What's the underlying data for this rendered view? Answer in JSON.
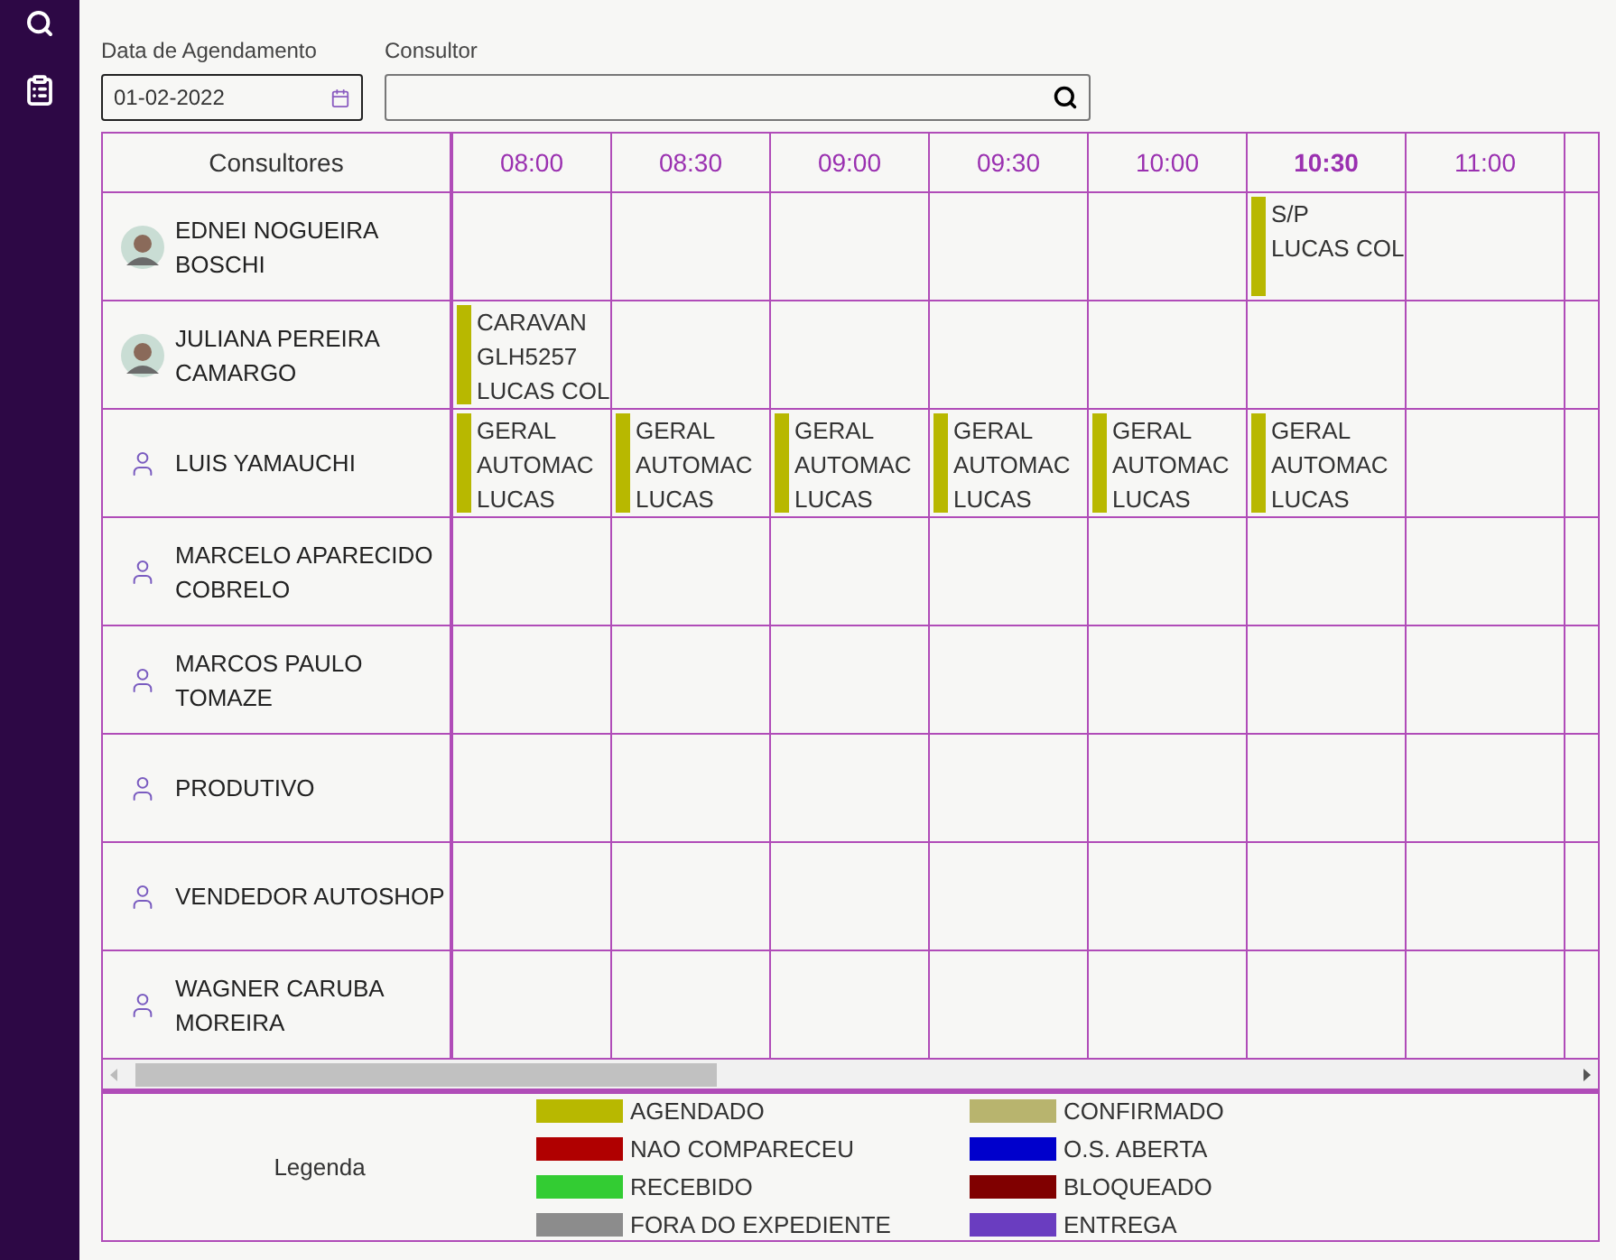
{
  "filters": {
    "date": {
      "label": "Data de Agendamento",
      "value": "01-02-2022"
    },
    "consultant": {
      "label": "Consultor"
    }
  },
  "schedule": {
    "header": "Consultores",
    "times": [
      {
        "label": "08:00",
        "current": false
      },
      {
        "label": "08:30",
        "current": false
      },
      {
        "label": "09:00",
        "current": false
      },
      {
        "label": "09:30",
        "current": false
      },
      {
        "label": "10:00",
        "current": false
      },
      {
        "label": "10:30",
        "current": true
      },
      {
        "label": "11:00",
        "current": false
      }
    ],
    "rows": [
      {
        "name": "EDNEI NOGUEIRA BOSCHI",
        "cells": [
          {
            "kind": "empty"
          },
          {
            "kind": "empty"
          },
          {
            "kind": "empty"
          },
          {
            "kind": "empty"
          },
          {
            "kind": "empty"
          },
          {
            "kind": "appointment",
            "color": "#b8b800",
            "lines": [
              "S/P",
              "LUCAS COL"
            ]
          },
          {
            "kind": "empty"
          }
        ]
      },
      {
        "name": "JULIANA PEREIRA CAMARGO",
        "cells": [
          {
            "kind": "appointment",
            "color": "#b8b800",
            "lines": [
              "CARAVAN",
              "GLH5257",
              "LUCAS COL"
            ]
          },
          {
            "kind": "empty"
          },
          {
            "kind": "empty"
          },
          {
            "kind": "empty"
          },
          {
            "kind": "empty"
          },
          {
            "kind": "empty"
          },
          {
            "kind": "empty"
          }
        ]
      },
      {
        "name": "LUIS YAMAUCHI",
        "kind": "user",
        "cells": [
          {
            "kind": "appointment",
            "color": "#b8b800",
            "lines": [
              "GERAL",
              "AUTOMAC",
              "LUCAS"
            ]
          },
          {
            "kind": "appointment",
            "color": "#b8b800",
            "lines": [
              "GERAL",
              "AUTOMAC",
              "LUCAS"
            ]
          },
          {
            "kind": "appointment",
            "color": "#b8b800",
            "lines": [
              "GERAL",
              "AUTOMAC",
              "LUCAS"
            ]
          },
          {
            "kind": "appointment",
            "color": "#b8b800",
            "lines": [
              "GERAL",
              "AUTOMAC",
              "LUCAS"
            ]
          },
          {
            "kind": "appointment",
            "color": "#b8b800",
            "lines": [
              "GERAL",
              "AUTOMAC",
              "LUCAS"
            ]
          },
          {
            "kind": "appointment",
            "color": "#b8b800",
            "lines": [
              "GERAL",
              "AUTOMAC",
              "LUCAS"
            ]
          },
          {
            "kind": "empty"
          }
        ]
      },
      {
        "name": "MARCELO APARECIDO COBRELO",
        "kind": "user",
        "cells": [
          {
            "kind": "empty"
          },
          {
            "kind": "empty"
          },
          {
            "kind": "empty"
          },
          {
            "kind": "empty"
          },
          {
            "kind": "empty"
          },
          {
            "kind": "empty"
          },
          {
            "kind": "empty"
          }
        ]
      },
      {
        "name": "MARCOS PAULO TOMAZE",
        "kind": "user",
        "cells": [
          {
            "kind": "empty"
          },
          {
            "kind": "empty"
          },
          {
            "kind": "empty"
          },
          {
            "kind": "empty"
          },
          {
            "kind": "empty"
          },
          {
            "kind": "empty"
          },
          {
            "kind": "empty"
          }
        ]
      },
      {
        "name": "PRODUTIVO",
        "kind": "user",
        "cells": [
          {
            "kind": "empty"
          },
          {
            "kind": "empty"
          },
          {
            "kind": "empty"
          },
          {
            "kind": "empty"
          },
          {
            "kind": "empty"
          },
          {
            "kind": "empty"
          },
          {
            "kind": "empty"
          }
        ]
      },
      {
        "name": "VENDEDOR AUTOSHOP",
        "kind": "user",
        "cells": [
          {
            "kind": "empty"
          },
          {
            "kind": "empty"
          },
          {
            "kind": "empty"
          },
          {
            "kind": "empty"
          },
          {
            "kind": "empty"
          },
          {
            "kind": "empty"
          },
          {
            "kind": "empty"
          }
        ]
      },
      {
        "name": "WAGNER CARUBA MOREIRA",
        "kind": "user",
        "cells": [
          {
            "kind": "empty"
          },
          {
            "kind": "empty"
          },
          {
            "kind": "empty"
          },
          {
            "kind": "empty"
          },
          {
            "kind": "empty"
          },
          {
            "kind": "empty"
          },
          {
            "kind": "empty"
          }
        ]
      }
    ]
  },
  "legend": {
    "title": "Legenda",
    "items": [
      {
        "label": "AGENDADO",
        "color": "#b8b800"
      },
      {
        "label": "CONFIRMADO",
        "color": "#b8b46e"
      },
      {
        "label": "NAO COMPARECEU",
        "color": "#b00000"
      },
      {
        "label": "O.S. ABERTA",
        "color": "#0000cc"
      },
      {
        "label": "RECEBIDO",
        "color": "#33cc33"
      },
      {
        "label": "BLOQUEADO",
        "color": "#800000"
      },
      {
        "label": "FORA DO EXPEDIENTE",
        "color": "#8c8c8c"
      },
      {
        "label": "ENTREGA",
        "color": "#6a3dc0"
      }
    ]
  }
}
